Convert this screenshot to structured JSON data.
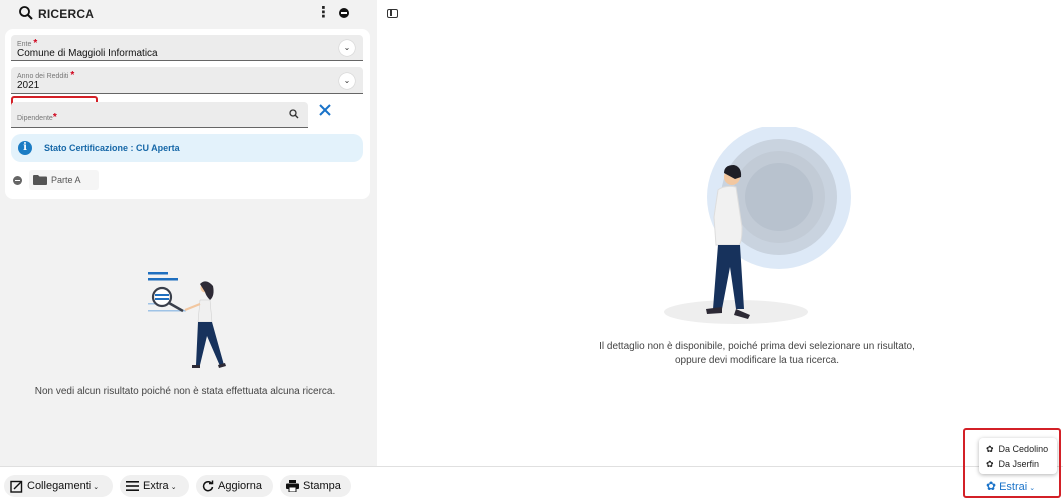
{
  "search": {
    "title": "RICERCA",
    "kebab": "⋮"
  },
  "form": {
    "ente_label": "Ente",
    "ente_value": "Comune di Maggioli Informatica",
    "anno_label": "Anno dei Redditi",
    "anno_value": "2021",
    "dipendente_label": "Dipendente",
    "required_mark": "*",
    "chevron": "⌄"
  },
  "banner": {
    "icon": "i",
    "text": "Stato Certificazione : CU Aperta"
  },
  "tree": {
    "node_label": "Parte A"
  },
  "left_empty": "Non vedi alcun risultato poiché non è stata effettuata alcuna ricerca.",
  "right_empty": {
    "line1": "Il dettaglio non è disponibile, poiché prima devi selezionare un risultato,",
    "line2": "oppure devi modificare la tua ricerca."
  },
  "toolbar": {
    "collegamenti": "Collegamenti",
    "extra": "Extra",
    "aggiorna": "Aggiorna",
    "stampa": "Stampa",
    "caret": "⌄"
  },
  "estrai": {
    "label": "Estrai",
    "menu": [
      "Da Cedolino",
      "Da Jserfin"
    ]
  },
  "colors": {
    "accent": "#1a73c9",
    "highlight": "#d32027",
    "info_bg": "#e3f2fb"
  }
}
